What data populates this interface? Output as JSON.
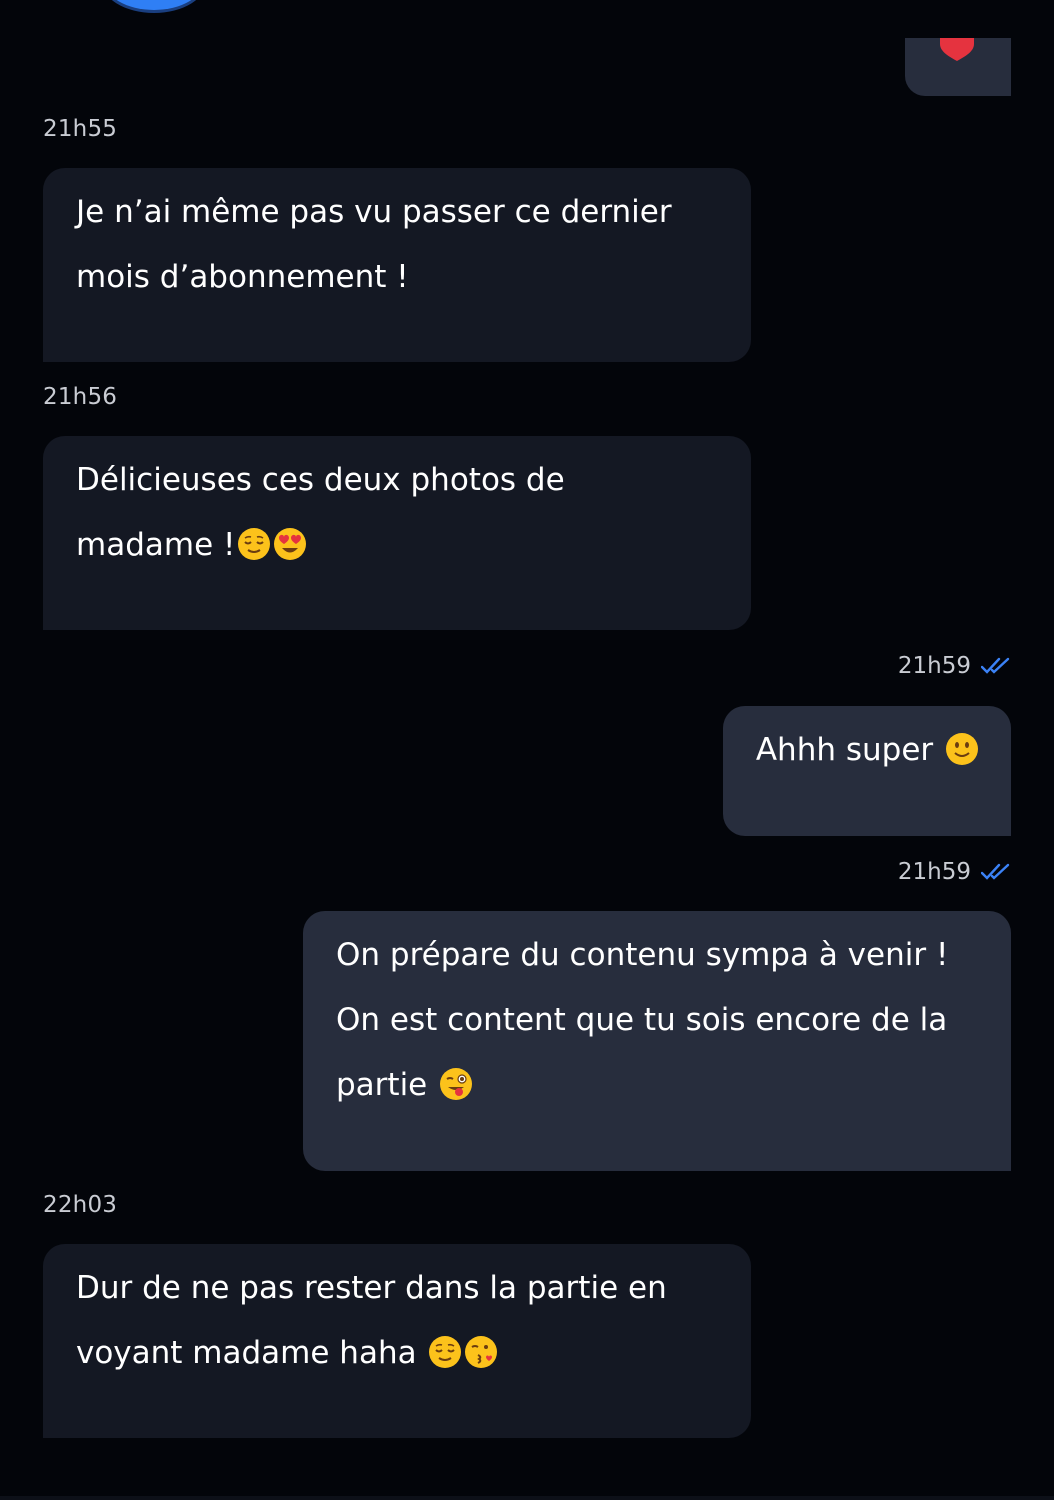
{
  "conversation": {
    "messages": [
      {
        "direction": "incoming",
        "time": "21h55",
        "text": "Je n’ai même pas vu passer ce dernier mois d’abonnement !",
        "lines": [
          "Je n’ai même pas vu passer ce dernier",
          "mois d’abonnement !"
        ]
      },
      {
        "direction": "incoming",
        "time": "21h56",
        "lines": [
          "Délicieuses ces deux photos de",
          "madame !"
        ],
        "emojis": [
          "relieved-face",
          "heart-eyes-face"
        ]
      },
      {
        "direction": "outgoing",
        "time": "21h59",
        "read": true,
        "lines": [
          "Ahhh super"
        ],
        "emojis": [
          "slightly-smiling-face"
        ]
      },
      {
        "direction": "outgoing",
        "time": "21h59",
        "read": true,
        "lines": [
          "On prépare du contenu sympa à venir !",
          "On est content que tu sois encore de la",
          "partie"
        ],
        "emojis": [
          "winking-tongue-face"
        ]
      },
      {
        "direction": "incoming",
        "time": "22h03",
        "lines": [
          "Dur de ne pas rester dans la partie en",
          "voyant madame haha"
        ],
        "emojis": [
          "relieved-face",
          "kissing-heart-face"
        ]
      }
    ]
  },
  "colors": {
    "background": "#03050a",
    "incoming_bubble": "#141823",
    "outgoing_bubble": "#272d3d",
    "read_check": "#3b82f6",
    "heart": "#e5333f"
  }
}
